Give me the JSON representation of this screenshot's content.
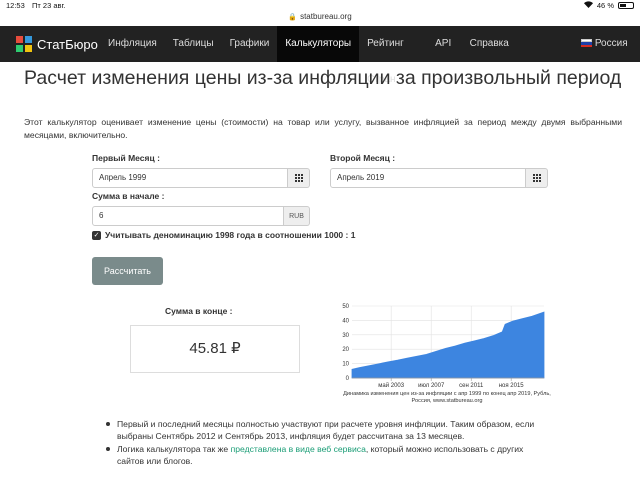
{
  "status": {
    "time": "12:53",
    "date": "Пт 23 авг.",
    "battery": "46 %",
    "battery_level": 0.46
  },
  "url": {
    "host": "statbureau.org"
  },
  "nav": {
    "brand": "СтатБюро",
    "items": [
      {
        "label": "Инфляция",
        "caret": false,
        "active": false
      },
      {
        "label": "Таблицы",
        "caret": false,
        "active": false
      },
      {
        "label": "Графики",
        "caret": true,
        "active": false
      },
      {
        "label": "Калькуляторы",
        "caret": false,
        "active": true
      },
      {
        "label": "Рейтинг Стран",
        "caret": false,
        "active": false
      },
      {
        "label": "API",
        "caret": true,
        "active": false
      },
      {
        "label": "Справка",
        "caret": false,
        "active": false
      }
    ],
    "country": "Россия",
    "colors": {
      "bg": "#222222",
      "active_bg": "#080808",
      "logo": [
        "#e74c3c",
        "#3498db",
        "#2ecc71",
        "#f1c40f"
      ]
    }
  },
  "page": {
    "title": "Расчет изменения цены из-за инфляции за произвольный период",
    "description": "Этот калькулятор оценивает изменение цены (стоимости) на товар или услугу, вызванное инфляцией за период между двумя выбранными месяцами, включительно."
  },
  "form": {
    "first_month_label": "Первый Месяц :",
    "first_month_value": "Апрель 1999",
    "second_month_label": "Второй Месяц :",
    "second_month_value": "Апрель 2019",
    "start_sum_label": "Сумма в начале :",
    "start_sum_value": "6",
    "currency": "RUB",
    "denomination_label": "Учитывать деноминацию 1998 года в соотношении 1000 : 1",
    "denomination_checked": true,
    "calculate_button": "Рассчитать"
  },
  "result": {
    "label": "Сумма в конце :",
    "value": "45.81 ₽"
  },
  "chart_data": {
    "type": "area",
    "x": [
      1999.25,
      2000,
      2001,
      2002,
      2003,
      2004,
      2005,
      2006,
      2007,
      2008,
      2009,
      2010,
      2011,
      2012,
      2013,
      2014,
      2014.9,
      2015.2,
      2016,
      2017,
      2018,
      2019.25
    ],
    "values": [
      6,
      7.2,
      8.5,
      9.8,
      11.2,
      12.4,
      13.8,
      15.1,
      16.4,
      18.5,
      20.6,
      22.2,
      24.2,
      25.8,
      27.4,
      29.5,
      32.0,
      37.3,
      39.5,
      41.2,
      42.9,
      45.81
    ],
    "x_ticks": [
      "май 2003",
      "июл 2007",
      "сен 2011",
      "ноя 2015"
    ],
    "y_ticks": [
      0,
      10,
      20,
      30,
      40,
      50
    ],
    "ylim": [
      0,
      50
    ],
    "grid": true,
    "color": "#3d85e0",
    "caption": "Динамика изменения цен из-за инфляции с апр 1999 по конец апр 2019, Рубль, Россия, www.statbureau.org"
  },
  "notes": {
    "item1": "Первый и последний месяцы полностью участвуют при расчете уровня инфляции. Таким образом, если выбраны Сентябрь 2012 и Сентябрь 2013, инфляция будет рассчитана за 13 месяцев.",
    "item2_before": "Логика калькулятора так же ",
    "item2_link": "представлена в виде веб сервиса",
    "item2_after": ", который можно использовать с других сайтов или блогов."
  }
}
